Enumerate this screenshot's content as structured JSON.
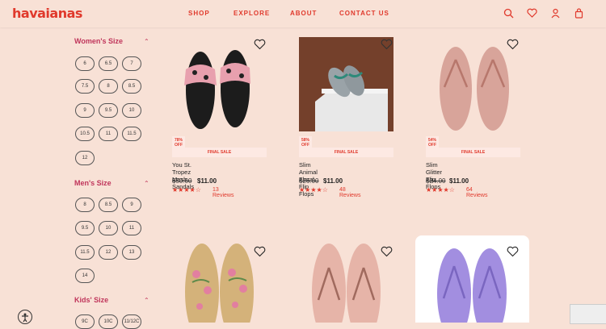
{
  "brand": {
    "logo": "havaianas"
  },
  "nav": {
    "items": [
      "SHOP",
      "EXPLORE",
      "ABOUT",
      "CONTACT US"
    ]
  },
  "header_icons": [
    "search-icon",
    "heart-icon",
    "user-icon",
    "bag-icon"
  ],
  "filters": {
    "womens": {
      "title": "Women's Size",
      "sizes": [
        "6",
        "6.5",
        "7",
        "7.5",
        "8",
        "8.5",
        "9",
        "9.5",
        "10",
        "10.5",
        "11",
        "11.5",
        "12"
      ]
    },
    "mens": {
      "title": "Men's Size",
      "sizes": [
        "8",
        "8.5",
        "9",
        "9.5",
        "10",
        "11",
        "11.5",
        "12",
        "13",
        "14"
      ]
    },
    "kids": {
      "title": "Kids' Size",
      "sizes": [
        "9C",
        "10C",
        "11/12C"
      ]
    }
  },
  "products": [
    {
      "badge": "78% OFF",
      "final": "FINAL SALE",
      "name": "You St. Tropez Mesh Sandals",
      "old": "$50.00",
      "new": "$11.00",
      "stars": "★★★★☆",
      "reviews": "13 Reviews"
    },
    {
      "badge": "58% OFF",
      "final": "FINAL SALE",
      "name": "Slim Animal Floral Flip Flops",
      "old": "$26.00",
      "new": "$11.00",
      "stars": "★★★★☆",
      "reviews": "48 Reviews"
    },
    {
      "badge": "54% OFF",
      "final": "FINAL SALE",
      "name": "Slim Glitter Flip Flops",
      "old": "$24.00",
      "new": "$11.00",
      "stars": "★★★★☆",
      "reviews": "64 Reviews"
    }
  ]
}
